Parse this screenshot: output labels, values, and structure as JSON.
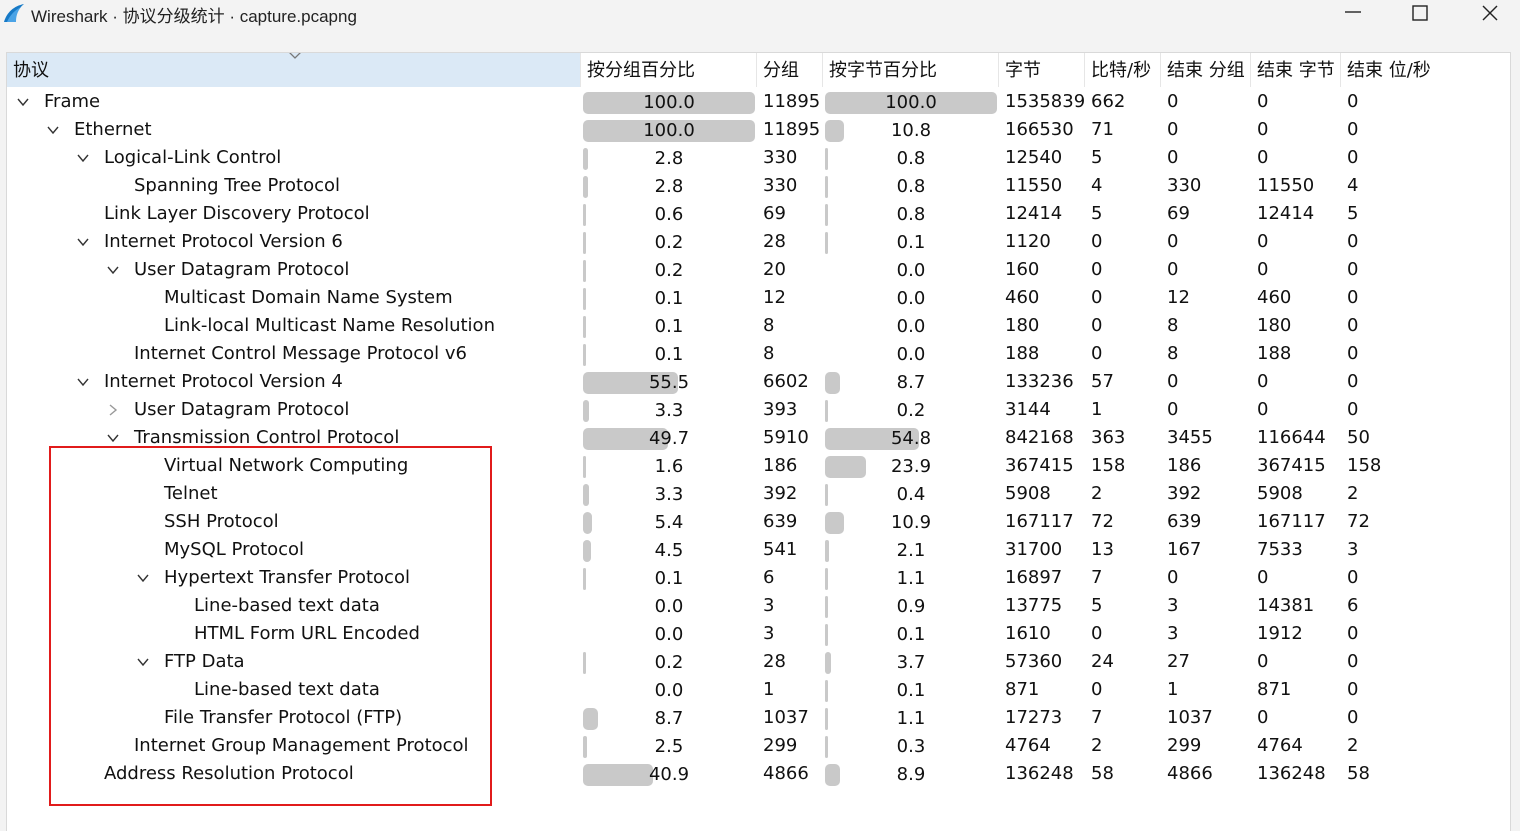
{
  "window": {
    "title": "Wireshark · 协议分级统计 · capture.pcapng"
  },
  "columns": [
    "协议",
    "按分组百分比",
    "分组",
    "按字节百分比",
    "字节",
    "比特/秒",
    "结束 分组",
    "结束 字节",
    "结束 位/秒"
  ],
  "colors": {
    "highlight_box": "#e11b1b",
    "bar_fill": "#c9c9c9",
    "sorted_header": "#dbe9f6"
  },
  "rows": [
    {
      "name": "Frame",
      "depth": 0,
      "toggle": "expanded",
      "pkt_pct": "100.0",
      "pkt_frac": 1.0,
      "packets": "11895",
      "byte_pct": "100.0",
      "byte_frac": 1.0,
      "bytes": "1535839",
      "bps": "662",
      "end_pkts": "0",
      "end_bytes": "0",
      "end_bps": "0"
    },
    {
      "name": "Ethernet",
      "depth": 1,
      "toggle": "expanded",
      "pkt_pct": "100.0",
      "pkt_frac": 1.0,
      "packets": "11895",
      "byte_pct": "10.8",
      "byte_frac": 0.108,
      "bytes": "166530",
      "bps": "71",
      "end_pkts": "0",
      "end_bytes": "0",
      "end_bps": "0"
    },
    {
      "name": "Logical-Link Control",
      "depth": 2,
      "toggle": "expanded",
      "pkt_pct": "2.8",
      "pkt_frac": 0.028,
      "packets": "330",
      "byte_pct": "0.8",
      "byte_frac": 0.008,
      "bytes": "12540",
      "bps": "5",
      "end_pkts": "0",
      "end_bytes": "0",
      "end_bps": "0"
    },
    {
      "name": "Spanning Tree Protocol",
      "depth": 3,
      "toggle": "none",
      "pkt_pct": "2.8",
      "pkt_frac": 0.028,
      "packets": "330",
      "byte_pct": "0.8",
      "byte_frac": 0.008,
      "bytes": "11550",
      "bps": "4",
      "end_pkts": "330",
      "end_bytes": "11550",
      "end_bps": "4"
    },
    {
      "name": "Link Layer Discovery Protocol",
      "depth": 2,
      "toggle": "none",
      "pkt_pct": "0.6",
      "pkt_frac": 0.006,
      "packets": "69",
      "byte_pct": "0.8",
      "byte_frac": 0.008,
      "bytes": "12414",
      "bps": "5",
      "end_pkts": "69",
      "end_bytes": "12414",
      "end_bps": "5"
    },
    {
      "name": "Internet Protocol Version 6",
      "depth": 2,
      "toggle": "expanded",
      "pkt_pct": "0.2",
      "pkt_frac": 0.002,
      "packets": "28",
      "byte_pct": "0.1",
      "byte_frac": 0.001,
      "bytes": "1120",
      "bps": "0",
      "end_pkts": "0",
      "end_bytes": "0",
      "end_bps": "0"
    },
    {
      "name": "User Datagram Protocol",
      "depth": 3,
      "toggle": "expanded",
      "pkt_pct": "0.2",
      "pkt_frac": 0.002,
      "packets": "20",
      "byte_pct": "0.0",
      "byte_frac": 0.0,
      "bytes": "160",
      "bps": "0",
      "end_pkts": "0",
      "end_bytes": "0",
      "end_bps": "0"
    },
    {
      "name": "Multicast Domain Name System",
      "depth": 4,
      "toggle": "none",
      "pkt_pct": "0.1",
      "pkt_frac": 0.001,
      "packets": "12",
      "byte_pct": "0.0",
      "byte_frac": 0.0,
      "bytes": "460",
      "bps": "0",
      "end_pkts": "12",
      "end_bytes": "460",
      "end_bps": "0"
    },
    {
      "name": "Link-local Multicast Name Resolution",
      "depth": 4,
      "toggle": "none",
      "pkt_pct": "0.1",
      "pkt_frac": 0.001,
      "packets": "8",
      "byte_pct": "0.0",
      "byte_frac": 0.0,
      "bytes": "180",
      "bps": "0",
      "end_pkts": "8",
      "end_bytes": "180",
      "end_bps": "0"
    },
    {
      "name": "Internet Control Message Protocol v6",
      "depth": 3,
      "toggle": "none",
      "pkt_pct": "0.1",
      "pkt_frac": 0.001,
      "packets": "8",
      "byte_pct": "0.0",
      "byte_frac": 0.0,
      "bytes": "188",
      "bps": "0",
      "end_pkts": "8",
      "end_bytes": "188",
      "end_bps": "0"
    },
    {
      "name": "Internet Protocol Version 4",
      "depth": 2,
      "toggle": "expanded",
      "pkt_pct": "55.5",
      "pkt_frac": 0.555,
      "packets": "6602",
      "byte_pct": "8.7",
      "byte_frac": 0.087,
      "bytes": "133236",
      "bps": "57",
      "end_pkts": "0",
      "end_bytes": "0",
      "end_bps": "0"
    },
    {
      "name": "User Datagram Protocol",
      "depth": 3,
      "toggle": "collapsed",
      "pkt_pct": "3.3",
      "pkt_frac": 0.033,
      "packets": "393",
      "byte_pct": "0.2",
      "byte_frac": 0.002,
      "bytes": "3144",
      "bps": "1",
      "end_pkts": "0",
      "end_bytes": "0",
      "end_bps": "0"
    },
    {
      "name": "Transmission Control Protocol",
      "depth": 3,
      "toggle": "expanded",
      "pkt_pct": "49.7",
      "pkt_frac": 0.497,
      "packets": "5910",
      "byte_pct": "54.8",
      "byte_frac": 0.548,
      "bytes": "842168",
      "bps": "363",
      "end_pkts": "3455",
      "end_bytes": "116644",
      "end_bps": "50"
    },
    {
      "name": "Virtual Network Computing",
      "depth": 4,
      "toggle": "none",
      "pkt_pct": "1.6",
      "pkt_frac": 0.016,
      "packets": "186",
      "byte_pct": "23.9",
      "byte_frac": 0.239,
      "bytes": "367415",
      "bps": "158",
      "end_pkts": "186",
      "end_bytes": "367415",
      "end_bps": "158"
    },
    {
      "name": "Telnet",
      "depth": 4,
      "toggle": "none",
      "pkt_pct": "3.3",
      "pkt_frac": 0.033,
      "packets": "392",
      "byte_pct": "0.4",
      "byte_frac": 0.004,
      "bytes": "5908",
      "bps": "2",
      "end_pkts": "392",
      "end_bytes": "5908",
      "end_bps": "2"
    },
    {
      "name": "SSH Protocol",
      "depth": 4,
      "toggle": "none",
      "pkt_pct": "5.4",
      "pkt_frac": 0.054,
      "packets": "639",
      "byte_pct": "10.9",
      "byte_frac": 0.109,
      "bytes": "167117",
      "bps": "72",
      "end_pkts": "639",
      "end_bytes": "167117",
      "end_bps": "72"
    },
    {
      "name": "MySQL Protocol",
      "depth": 4,
      "toggle": "none",
      "pkt_pct": "4.5",
      "pkt_frac": 0.045,
      "packets": "541",
      "byte_pct": "2.1",
      "byte_frac": 0.021,
      "bytes": "31700",
      "bps": "13",
      "end_pkts": "167",
      "end_bytes": "7533",
      "end_bps": "3"
    },
    {
      "name": "Hypertext Transfer Protocol",
      "depth": 4,
      "toggle": "expanded",
      "pkt_pct": "0.1",
      "pkt_frac": 0.001,
      "packets": "6",
      "byte_pct": "1.1",
      "byte_frac": 0.011,
      "bytes": "16897",
      "bps": "7",
      "end_pkts": "0",
      "end_bytes": "0",
      "end_bps": "0"
    },
    {
      "name": "Line-based text data",
      "depth": 5,
      "toggle": "none",
      "pkt_pct": "0.0",
      "pkt_frac": 0.0,
      "packets": "3",
      "byte_pct": "0.9",
      "byte_frac": 0.009,
      "bytes": "13775",
      "bps": "5",
      "end_pkts": "3",
      "end_bytes": "14381",
      "end_bps": "6"
    },
    {
      "name": "HTML Form URL Encoded",
      "depth": 5,
      "toggle": "none",
      "pkt_pct": "0.0",
      "pkt_frac": 0.0,
      "packets": "3",
      "byte_pct": "0.1",
      "byte_frac": 0.001,
      "bytes": "1610",
      "bps": "0",
      "end_pkts": "3",
      "end_bytes": "1912",
      "end_bps": "0"
    },
    {
      "name": "FTP Data",
      "depth": 4,
      "toggle": "expanded",
      "pkt_pct": "0.2",
      "pkt_frac": 0.002,
      "packets": "28",
      "byte_pct": "3.7",
      "byte_frac": 0.037,
      "bytes": "57360",
      "bps": "24",
      "end_pkts": "27",
      "end_bytes": "0",
      "end_bps": "0"
    },
    {
      "name": "Line-based text data",
      "depth": 5,
      "toggle": "none",
      "pkt_pct": "0.0",
      "pkt_frac": 0.0,
      "packets": "1",
      "byte_pct": "0.1",
      "byte_frac": 0.001,
      "bytes": "871",
      "bps": "0",
      "end_pkts": "1",
      "end_bytes": "871",
      "end_bps": "0"
    },
    {
      "name": "File Transfer Protocol (FTP)",
      "depth": 4,
      "toggle": "none",
      "pkt_pct": "8.7",
      "pkt_frac": 0.087,
      "packets": "1037",
      "byte_pct": "1.1",
      "byte_frac": 0.011,
      "bytes": "17273",
      "bps": "7",
      "end_pkts": "1037",
      "end_bytes": "0",
      "end_bps": "0"
    },
    {
      "name": "Internet Group Management Protocol",
      "depth": 3,
      "toggle": "none",
      "pkt_pct": "2.5",
      "pkt_frac": 0.025,
      "packets": "299",
      "byte_pct": "0.3",
      "byte_frac": 0.003,
      "bytes": "4764",
      "bps": "2",
      "end_pkts": "299",
      "end_bytes": "4764",
      "end_bps": "2"
    },
    {
      "name": "Address Resolution Protocol",
      "depth": 2,
      "toggle": "none",
      "pkt_pct": "40.9",
      "pkt_frac": 0.409,
      "packets": "4866",
      "byte_pct": "8.9",
      "byte_frac": 0.089,
      "bytes": "136248",
      "bps": "58",
      "end_pkts": "4866",
      "end_bytes": "136248",
      "end_bps": "58"
    }
  ]
}
